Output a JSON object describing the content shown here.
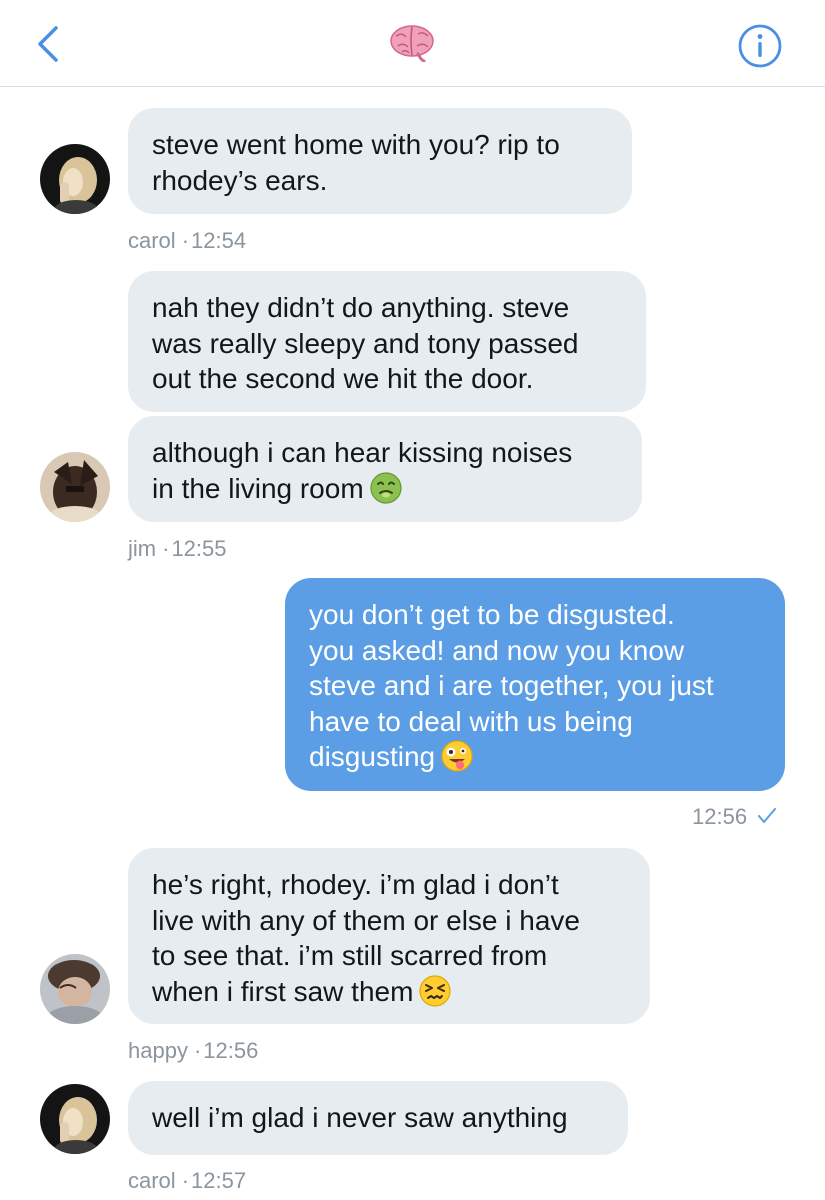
{
  "header": {
    "back_icon": "chevron-left-icon",
    "title_icon": "brain-emoji-icon",
    "info_icon": "info-circle-icon",
    "accent_color": "#4a90e2"
  },
  "colors": {
    "received_bubble": "#e6ecf0",
    "sent_bubble": "#5b9ee6",
    "meta_text": "#8a959e"
  },
  "messages": [
    {
      "sender": "carol",
      "lines": [
        "steve went home with you? rip to",
        "rhodey’s ears."
      ],
      "time": "12:54"
    },
    {
      "sender": "jim",
      "lines": [
        "nah they didn’t do anything. steve",
        "was really sleepy and tony passed",
        "out the second we hit the door."
      ]
    },
    {
      "sender": "jim",
      "lines": [
        "although i can hear kissing noises",
        "in the living room"
      ],
      "emoji": "nauseated-face-emoji",
      "time": "12:55"
    },
    {
      "sender": "me",
      "lines": [
        "you don’t get to be disgusted.",
        "you asked! and now you know",
        "steve and i are together, you just",
        "have to deal with us being",
        "disgusting"
      ],
      "emoji": "zany-face-emoji",
      "time": "12:56",
      "status_icon": "checkmark-icon"
    },
    {
      "sender": "happy",
      "lines": [
        "he’s right, rhodey. i’m glad i don’t",
        "live with any of them or else i have",
        "to see that. i’m still scarred from",
        "when i first saw them"
      ],
      "emoji": "confounded-face-emoji",
      "time": "12:56"
    },
    {
      "sender": "carol",
      "lines": [
        "well i’m glad i never saw anything"
      ],
      "time": "12:57"
    }
  ],
  "meta_separator": "·"
}
